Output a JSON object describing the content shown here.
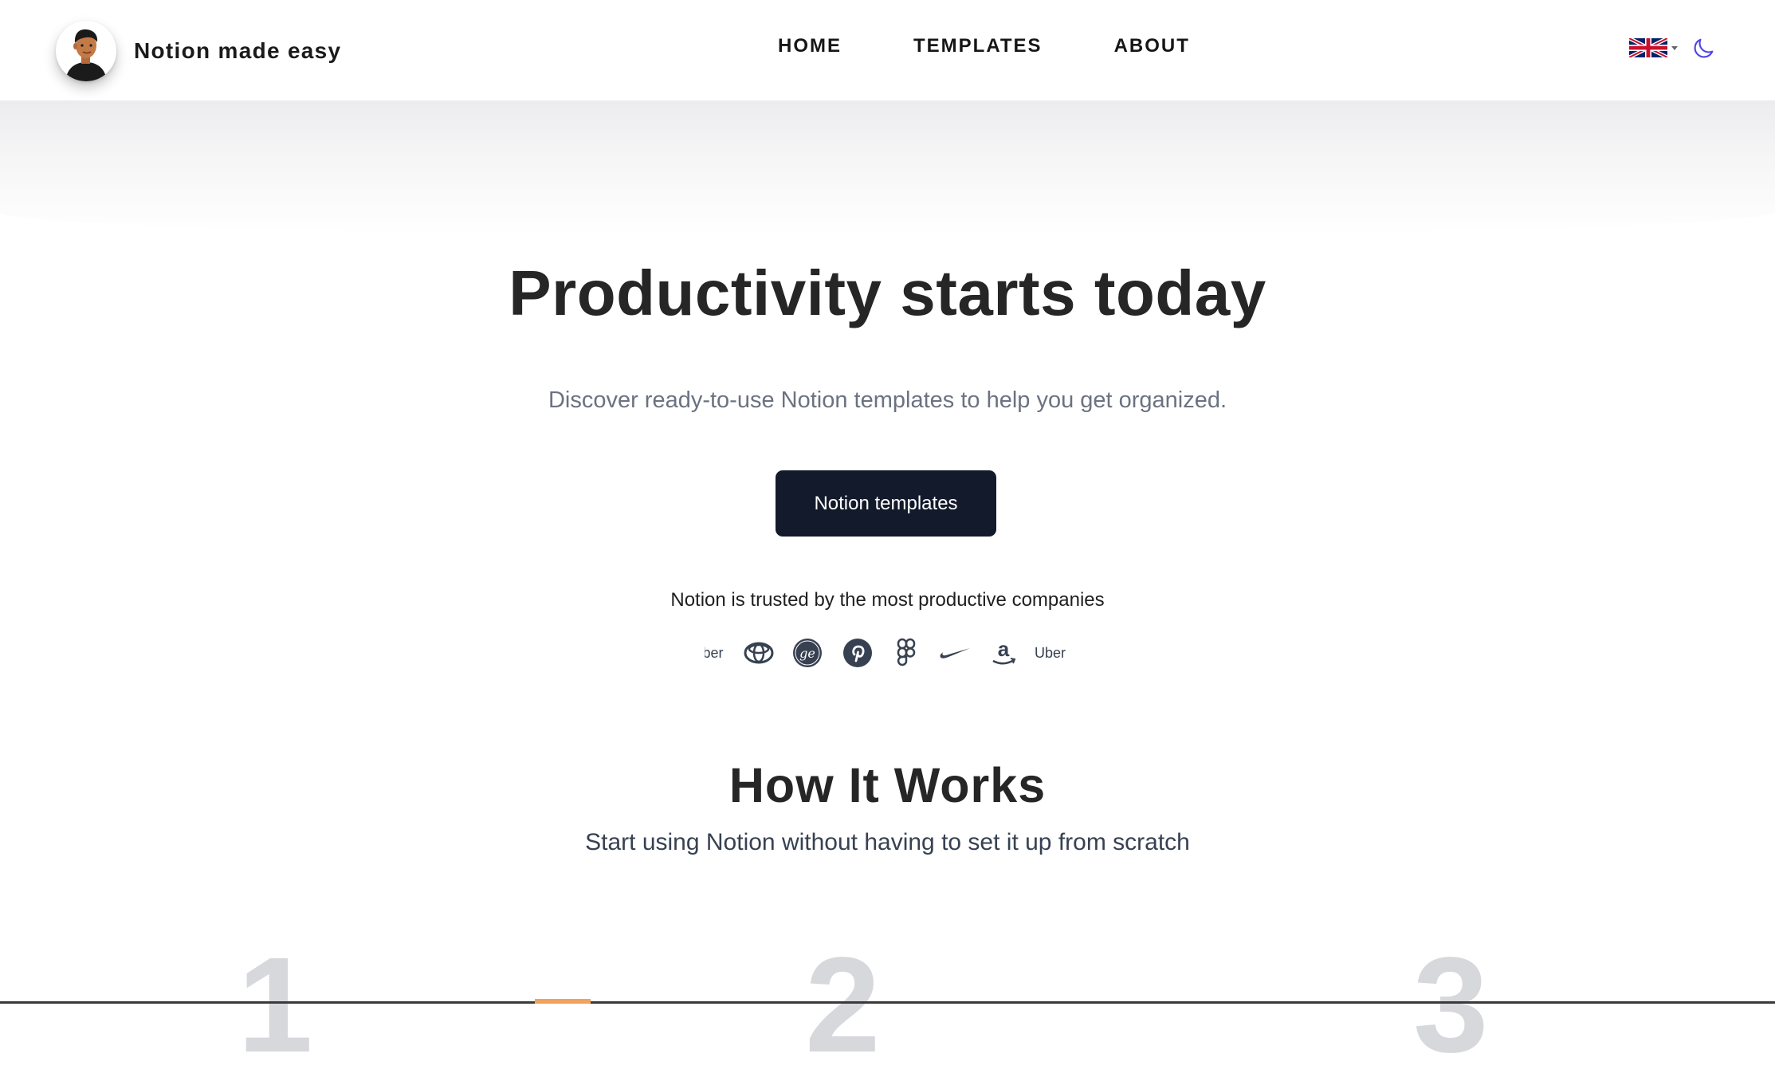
{
  "header": {
    "brand_name": "Notion made easy",
    "nav": [
      {
        "label": "HOME"
      },
      {
        "label": "TEMPLATES"
      },
      {
        "label": "ABOUT"
      }
    ],
    "language_icon": "uk-flag-icon",
    "theme_icon": "moon-icon"
  },
  "hero": {
    "title": "Productivity starts today",
    "subtitle": "Discover ready-to-use Notion templates to help you get organized.",
    "cta_label": "Notion templates",
    "trusted_text": "Notion is trusted by the most productive companies",
    "logos": [
      {
        "name": "uber-logo",
        "text": "Uber"
      },
      {
        "name": "toyota-logo"
      },
      {
        "name": "ge-logo"
      },
      {
        "name": "pinterest-logo"
      },
      {
        "name": "figma-logo"
      },
      {
        "name": "nike-logo"
      },
      {
        "name": "amazon-logo"
      },
      {
        "name": "uber-logo",
        "text": "Uber"
      }
    ]
  },
  "how_it_works": {
    "title": "How It Works",
    "subtitle": "Start using Notion without having to set it up from scratch",
    "steps": [
      "1",
      "2",
      "3"
    ]
  },
  "colors": {
    "cta_background": "#131a2b",
    "accent_moon": "#4f46e5",
    "step_number": "#d6d8dc",
    "subtitle_gray": "#6b7280"
  }
}
